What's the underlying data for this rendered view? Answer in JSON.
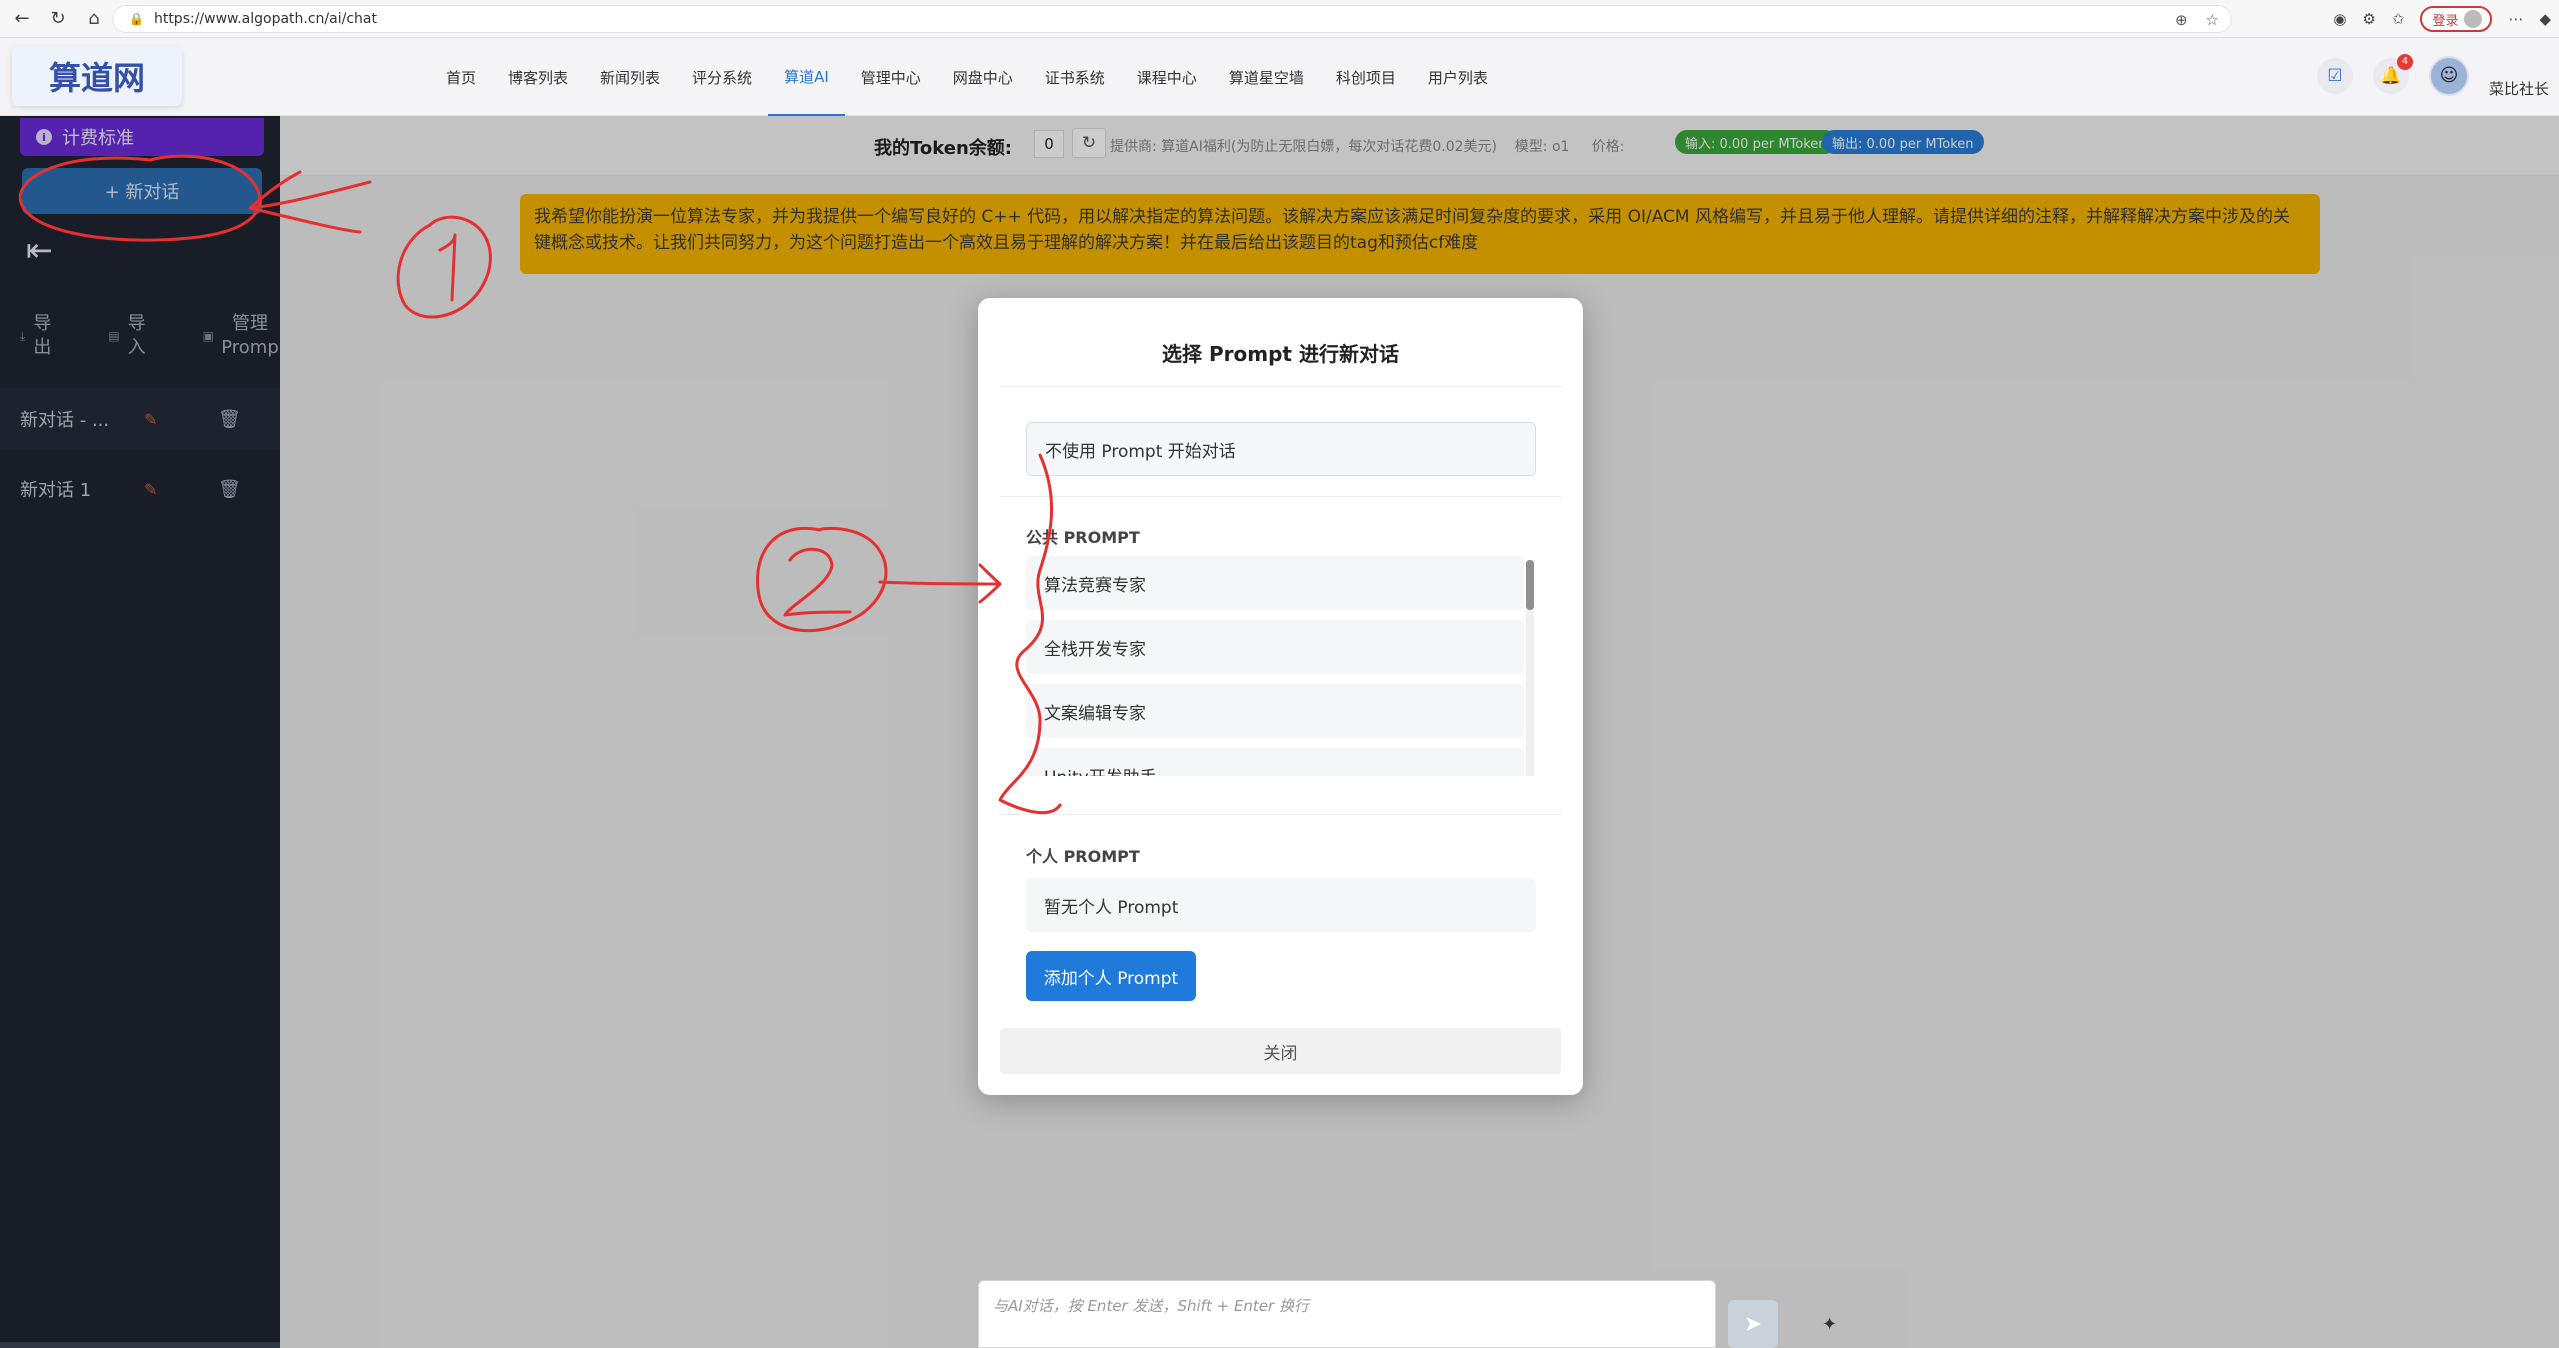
{
  "browser": {
    "url": "https://www.algopath.cn/ai/chat",
    "login_label": "登录"
  },
  "header": {
    "logo": "算道网",
    "nav": [
      "首页",
      "博客列表",
      "新闻列表",
      "评分系统",
      "算道AI",
      "管理中心",
      "网盘中心",
      "证书系统",
      "课程中心",
      "算道星空墙",
      "科创项目",
      "用户列表"
    ],
    "active_nav": "算道AI",
    "notification_count": "4",
    "username": "菜比社长"
  },
  "sidebar": {
    "billing_label": "计费标准",
    "new_chat_label": "+ 新对话",
    "tools": {
      "export": "导出",
      "import": "导入",
      "manage": "管理Promp"
    },
    "conversations": [
      {
        "label": "新对话 - ..."
      },
      {
        "label": "新对话 1"
      }
    ]
  },
  "token_bar": {
    "label": "我的Token余额:",
    "value": "0",
    "provider": "提供商: 算道AI福利(为防止无限白嫖，每次对话花费0.02美元)",
    "model": "模型: o1",
    "price_label": "价格:",
    "input_price": "输入: 0.00 per MToken",
    "output_price": "输出: 0.00 per MToken",
    "input_color": "#3aa83a",
    "output_color": "#2a7ed8"
  },
  "system_prompt": "我希望你能扮演一位算法专家，并为我提供一个编写良好的 C++ 代码，用以解决指定的算法问题。该解决方案应该满足时间复杂度的要求，采用 OI/ACM 风格编写，并且易于他人理解。请提供详细的注释，并解释解决方案中涉及的关键概念或技术。让我们共同努力，为这个问题打造出一个高效且易于理解的解决方案！并在最后给出该题目的tag和预估cf难度",
  "modal": {
    "title": "选择 Prompt 进行新对话",
    "no_prompt": "不使用 Prompt 开始对话",
    "public_title": "公共 PROMPT",
    "public_prompts": [
      "算法竞赛专家",
      "全栈开发专家",
      "文案编辑专家",
      "Unity开发助手"
    ],
    "personal_title": "个人 PROMPT",
    "personal_empty": "暂无个人 Prompt",
    "add_personal": "添加个人 Prompt",
    "close": "关闭"
  },
  "input": {
    "placeholder": "与AI对话，按 Enter 发送，Shift + Enter 换行"
  },
  "colors": {
    "sidebar_bg": "#1e2532",
    "billing_bg": "#6a2bd9",
    "new_chat_bg": "#2c6fb3",
    "prompt_bg": "#f5b400",
    "accent": "#1f7ad9",
    "annotation": "#e53030"
  },
  "annotations": [
    "①",
    "②"
  ]
}
